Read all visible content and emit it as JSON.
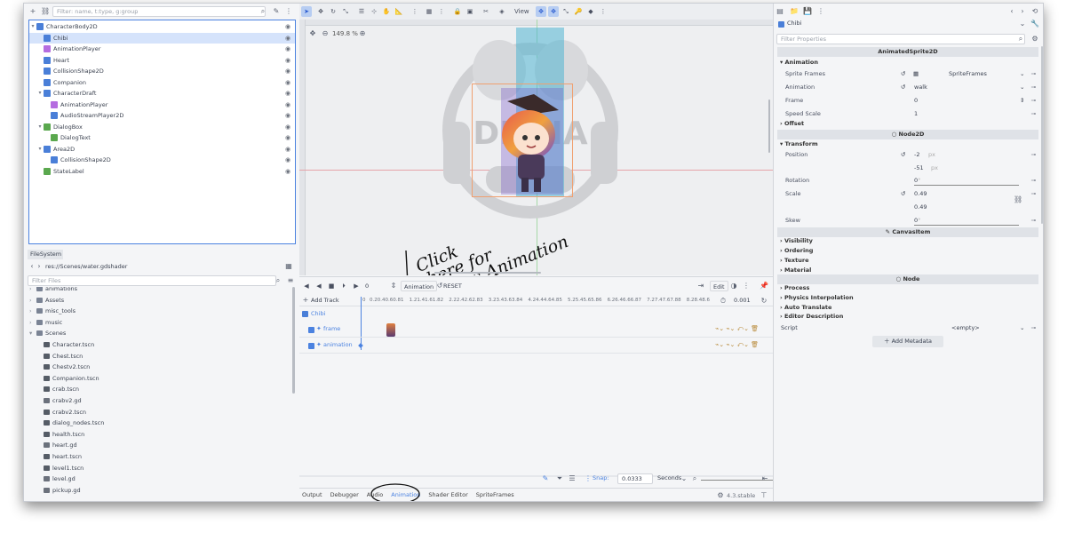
{
  "scene_dock": {
    "filter_placeholder": "Filter: name, t:type, g:group",
    "nodes": [
      {
        "label": "CharacterBody2D",
        "icon": "characterbody2d-icon",
        "color": "#4a7fd8",
        "indent": 0,
        "toggle": "▾"
      },
      {
        "label": "Chibi",
        "icon": "animatedsprite2d-icon",
        "color": "#4a7fd8",
        "indent": 1,
        "toggle": "",
        "selected": true
      },
      {
        "label": "AnimationPlayer",
        "icon": "animationplayer-icon",
        "color": "#b56de0",
        "indent": 1,
        "toggle": ""
      },
      {
        "label": "Heart",
        "icon": "node2d-icon",
        "color": "#4a7fd8",
        "indent": 1,
        "toggle": ""
      },
      {
        "label": "CollisionShape2D",
        "icon": "collisionshape2d-icon",
        "color": "#4a7fd8",
        "indent": 1,
        "toggle": ""
      },
      {
        "label": "Companion",
        "icon": "node2d-icon",
        "color": "#4a7fd8",
        "indent": 1,
        "toggle": ""
      },
      {
        "label": "CharacterDraft",
        "icon": "characterbody2d-icon",
        "color": "#4a7fd8",
        "indent": 1,
        "toggle": "▾"
      },
      {
        "label": "AnimationPlayer",
        "icon": "animationplayer-icon",
        "color": "#b56de0",
        "indent": 2,
        "toggle": ""
      },
      {
        "label": "AudioStreamPlayer2D",
        "icon": "audio-icon",
        "color": "#4a7fd8",
        "indent": 2,
        "toggle": ""
      },
      {
        "label": "DialogBox",
        "icon": "control-icon",
        "color": "#5aa84e",
        "indent": 1,
        "toggle": "▾"
      },
      {
        "label": "DialogText",
        "icon": "label-icon",
        "color": "#5aa84e",
        "indent": 2,
        "toggle": ""
      },
      {
        "label": "Area2D",
        "icon": "area2d-icon",
        "color": "#4a7fd8",
        "indent": 1,
        "toggle": "▾"
      },
      {
        "label": "CollisionShape2D",
        "icon": "collisionshape2d-icon",
        "color": "#4a7fd8",
        "indent": 2,
        "toggle": ""
      },
      {
        "label": "StateLabel",
        "icon": "label-icon",
        "color": "#5aa84e",
        "indent": 1,
        "toggle": ""
      }
    ]
  },
  "filesystem": {
    "tab": "FileSystem",
    "path": "res://Scenes/water.gdshader",
    "filter_placeholder": "Filter Files",
    "items": [
      {
        "label": "animations",
        "type": "folder",
        "indent": 1,
        "toggle": "›"
      },
      {
        "label": "Assets",
        "type": "folder",
        "indent": 1,
        "toggle": "›"
      },
      {
        "label": "misc_tools",
        "type": "folder",
        "indent": 1,
        "toggle": "›"
      },
      {
        "label": "music",
        "type": "folder",
        "indent": 1,
        "toggle": "›"
      },
      {
        "label": "Scenes",
        "type": "folder",
        "indent": 1,
        "toggle": "▾"
      },
      {
        "label": "Character.tscn",
        "type": "scene",
        "indent": 2,
        "toggle": ""
      },
      {
        "label": "Chest.tscn",
        "type": "scene",
        "indent": 2,
        "toggle": ""
      },
      {
        "label": "Chestv2.tscn",
        "type": "scene",
        "indent": 2,
        "toggle": ""
      },
      {
        "label": "Companion.tscn",
        "type": "scene",
        "indent": 2,
        "toggle": ""
      },
      {
        "label": "crab.tscn",
        "type": "scene",
        "indent": 2,
        "toggle": ""
      },
      {
        "label": "crabv2.gd",
        "type": "script",
        "indent": 2,
        "toggle": ""
      },
      {
        "label": "crabv2.tscn",
        "type": "scene",
        "indent": 2,
        "toggle": ""
      },
      {
        "label": "dialog_nodes.tscn",
        "type": "scene",
        "indent": 2,
        "toggle": ""
      },
      {
        "label": "health.tscn",
        "type": "scene",
        "indent": 2,
        "toggle": ""
      },
      {
        "label": "heart.gd",
        "type": "script",
        "indent": 2,
        "toggle": ""
      },
      {
        "label": "heart.tscn",
        "type": "scene",
        "indent": 2,
        "toggle": ""
      },
      {
        "label": "level1.tscn",
        "type": "scene",
        "indent": 2,
        "toggle": ""
      },
      {
        "label": "level.gd",
        "type": "script",
        "indent": 2,
        "toggle": ""
      },
      {
        "label": "pickup.gd",
        "type": "script",
        "indent": 2,
        "toggle": ""
      }
    ]
  },
  "viewport": {
    "view_menu": "View",
    "zoom": "149.8 %",
    "watermark": "DIANA"
  },
  "annotation": {
    "text_line1": "Click",
    "text_line2": "here for",
    "text_line3": "new Animation"
  },
  "animation_panel": {
    "frame_value": "0",
    "animation_label": "Animation",
    "animation_selected": "RESET",
    "edit_label": "Edit",
    "add_track": "Add Track",
    "ruler": [
      "0",
      "0.20.40.60.81",
      "1.21.41.61.82",
      "2.22.42.62.83",
      "3.23.43.63.84",
      "4.24.44.64.85",
      "5.25.45.65.86",
      "6.26.46.66.87",
      "7.27.47.67.88",
      "8.28.48.6"
    ],
    "step": "0.001",
    "node_track": "Chibi",
    "tracks": [
      {
        "name": "frame"
      },
      {
        "name": "animation"
      }
    ],
    "snap_label": "Snap:",
    "snap_value": "0.0333",
    "time_unit": "Seconds"
  },
  "bottom_tabs": [
    "Output",
    "Debugger",
    "Audio",
    "Animation",
    "Shader Editor",
    "SpriteFrames"
  ],
  "active_bottom_tab": "Animation",
  "version": "4.3.stable",
  "inspector": {
    "node_name": "Chibi",
    "filter_placeholder": "Filter Properties",
    "class_header": "AnimatedSprite2D",
    "animation_group": "Animation",
    "sprite_frames_label": "Sprite Frames",
    "sprite_frames_value": "SpriteFrames",
    "animation_label": "Animation",
    "animation_value": "walk",
    "frame_label": "Frame",
    "frame_value": "0",
    "speed_scale_label": "Speed Scale",
    "speed_scale_value": "1",
    "offset_group": "Offset",
    "node2d_header": "Node2D",
    "transform_group": "Transform",
    "position_label": "Position",
    "position_x": "-2",
    "position_y": "-51",
    "px_unit": "px",
    "rotation_label": "Rotation",
    "rotation_value": "0",
    "degree_unit": "°",
    "scale_label": "Scale",
    "scale_x": "0.49",
    "scale_y": "0.49",
    "skew_label": "Skew",
    "skew_value": "0",
    "canvasitem_header": "CanvasItem",
    "canvas_groups": [
      "Visibility",
      "Ordering",
      "Texture",
      "Material"
    ],
    "node_header": "Node",
    "node_groups": [
      "Process",
      "Physics Interpolation",
      "Auto Translate",
      "Editor Description"
    ],
    "script_label": "Script",
    "script_value": "<empty>",
    "add_metadata": "Add Metadata"
  }
}
